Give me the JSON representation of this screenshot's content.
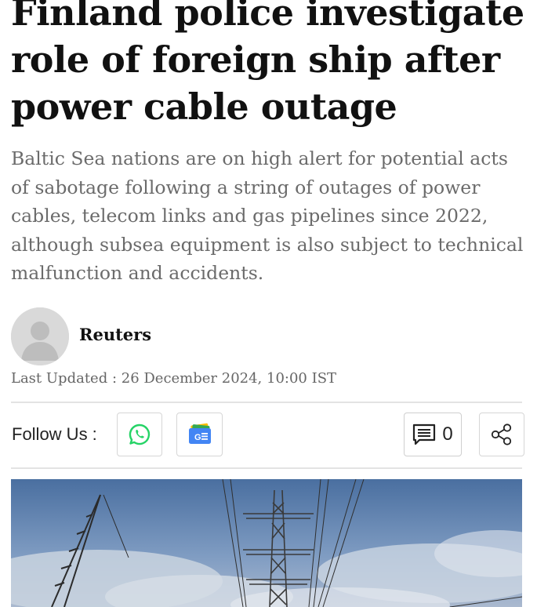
{
  "article": {
    "headline_lines": [
      "Finland police investigate",
      "role of foreign ship after",
      "power cable outage"
    ],
    "summary": "Baltic Sea nations are on high alert for potential acts of sabotage following a string of outages of power cables, telecom links and gas pipelines since 2022, although subsea equipment is also subject to technical malfunction and accidents.",
    "author": "Reuters",
    "last_updated": "Last Updated : 26 December 2024, 10:00 IST"
  },
  "social": {
    "follow_label": "Follow Us :",
    "buttons": [
      {
        "icon": "whatsapp-icon",
        "color": "#25D366"
      },
      {
        "icon": "google-news-icon",
        "colors": [
          "#4285F4",
          "#EA4335",
          "#FBBC05",
          "#34A853"
        ]
      }
    ],
    "comment_count": "0",
    "share_icon": "share-icon"
  },
  "colors": {
    "headline": "#111111",
    "summary": "#6b6b6b",
    "divider": "#e3e3e3"
  }
}
